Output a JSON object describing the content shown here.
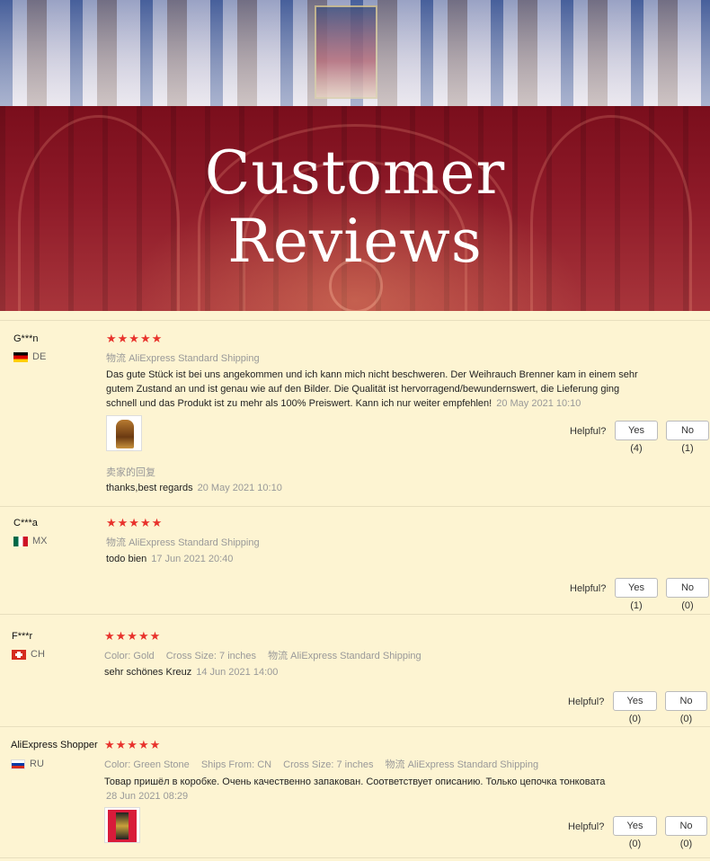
{
  "banner": {
    "title_line1": "Customer",
    "title_line2": "Reviews"
  },
  "helpful_label": "Helpful?",
  "reviews": [
    {
      "user": "G***n",
      "country": "DE",
      "flag": "germany-flag",
      "rating": 5,
      "stars": "★★★★★",
      "meta": [
        {
          "key": "物流",
          "value": "AliExpress Standard Shipping"
        }
      ],
      "text": "Das gute Stück ist bei uns angekommen und ich kann mich nicht beschweren. Der Weihrauch Brenner kam in einem sehr gutem Zustand an und ist genau wie auf den Bilder. Die Qualität ist hervorragend/bewundernswert, die Lieferung ging schnell und das Produkt ist zu mehr als 100% Preiswert. Kann ich nur weiter empfehlen!",
      "date": "20 May 2021 10:10",
      "reply_label": "卖家的回复",
      "reply_text": "thanks,best regards",
      "reply_date": "20 May 2021 10:10",
      "yes": "Yes (4)",
      "no": "No (1)"
    },
    {
      "user": "C***a",
      "country": "MX",
      "flag": "mexico-flag",
      "rating": 5,
      "stars": "★★★★★",
      "meta": [
        {
          "key": "物流",
          "value": "AliExpress Standard Shipping"
        }
      ],
      "text": "todo bien",
      "date": "17 Jun 2021 20:40",
      "yes": "Yes (1)",
      "no": "No (0)"
    },
    {
      "user": "F***r",
      "country": "CH",
      "flag": "switzerland-flag",
      "rating": 5,
      "stars": "★★★★★",
      "meta": [
        {
          "key": "Color:",
          "value": "Gold"
        },
        {
          "key": "Cross Size:",
          "value": "7 inches"
        },
        {
          "key": "物流",
          "value": "AliExpress Standard Shipping"
        }
      ],
      "text": "sehr schönes Kreuz",
      "date": "14 Jun 2021 14:00",
      "yes": "Yes (0)",
      "no": "No (0)"
    },
    {
      "user": "AliExpress Shopper",
      "country": "RU",
      "flag": "russia-flag",
      "rating": 5,
      "stars": "★★★★★",
      "meta": [
        {
          "key": "Color:",
          "value": "Green Stone"
        },
        {
          "key": "Ships From:",
          "value": "CN"
        },
        {
          "key": "Cross Size:",
          "value": "7 inches"
        },
        {
          "key": "物流",
          "value": "AliExpress Standard Shipping"
        }
      ],
      "text": "Товар пришёл в коробке. Очень качественно запакован. Соответствует описанию. Только цепочка тонковата",
      "date": "28 Jun 2021 08:29",
      "yes": "Yes (0)",
      "no": "No (0)"
    }
  ],
  "colors": {
    "background": "#fdf4d2",
    "banner": "#8e1a28",
    "star": "#e8322c"
  }
}
